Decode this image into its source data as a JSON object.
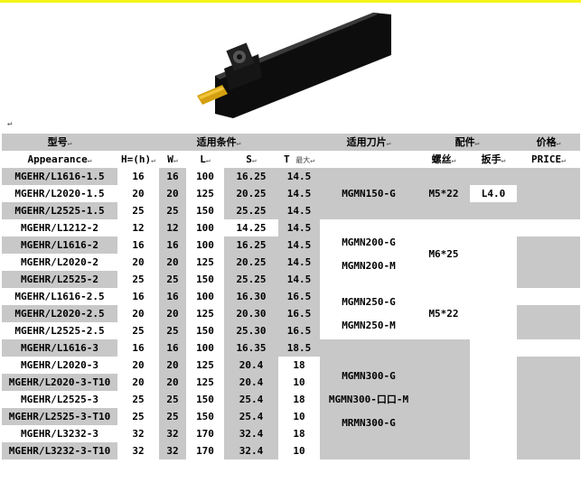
{
  "header": {
    "model": "型号",
    "conditions": "适用条件",
    "insert": "适用刀片",
    "accessories": "配件",
    "price": "价格"
  },
  "subheader": {
    "appearance": "Appearance",
    "h": "H=(h)",
    "w": "W",
    "l": "L",
    "s": "S",
    "t": "T",
    "t_sub": "最大",
    "screw": "螺丝",
    "wrench": "扳手",
    "price": "PRICE"
  },
  "rows": [
    {
      "model": "MGEHR/L1616-1.5",
      "h": "16",
      "w": "16",
      "l": "100",
      "s": "16.25",
      "t": "14.5"
    },
    {
      "model": "MGEHR/L2020-1.5",
      "h": "20",
      "w": "20",
      "l": "125",
      "s": "20.25",
      "t": "14.5"
    },
    {
      "model": "MGEHR/L2525-1.5",
      "h": "25",
      "w": "25",
      "l": "150",
      "s": "25.25",
      "t": "14.5"
    },
    {
      "model": "MGEHR/L1212-2",
      "h": "12",
      "w": "12",
      "l": "100",
      "s": "14.25",
      "t": "14.5"
    },
    {
      "model": "MGEHR/L1616-2",
      "h": "16",
      "w": "16",
      "l": "100",
      "s": "16.25",
      "t": "14.5"
    },
    {
      "model": "MGEHR/L2020-2",
      "h": "20",
      "w": "20",
      "l": "125",
      "s": "20.25",
      "t": "14.5"
    },
    {
      "model": "MGEHR/L2525-2",
      "h": "25",
      "w": "25",
      "l": "150",
      "s": "25.25",
      "t": "14.5"
    },
    {
      "model": "MGEHR/L1616-2.5",
      "h": "16",
      "w": "16",
      "l": "100",
      "s": "16.30",
      "t": "16.5"
    },
    {
      "model": "MGEHR/L2020-2.5",
      "h": "20",
      "w": "20",
      "l": "125",
      "s": "20.30",
      "t": "16.5"
    },
    {
      "model": "MGEHR/L2525-2.5",
      "h": "25",
      "w": "25",
      "l": "150",
      "s": "25.30",
      "t": "16.5"
    },
    {
      "model": "MGEHR/L1616-3",
      "h": "16",
      "w": "16",
      "l": "100",
      "s": "16.35",
      "t": "18.5"
    },
    {
      "model": "MGEHR/L2020-3",
      "h": "20",
      "w": "20",
      "l": "125",
      "s": "20.4",
      "t": "18"
    },
    {
      "model": "MGEHR/L2020-3-T10",
      "h": "20",
      "w": "20",
      "l": "125",
      "s": "20.4",
      "t": "10"
    },
    {
      "model": "MGEHR/L2525-3",
      "h": "25",
      "w": "25",
      "l": "150",
      "s": "25.4",
      "t": "18"
    },
    {
      "model": "MGEHR/L2525-3-T10",
      "h": "25",
      "w": "25",
      "l": "150",
      "s": "25.4",
      "t": "10"
    },
    {
      "model": "MGEHR/L3232-3",
      "h": "32",
      "w": "32",
      "l": "170",
      "s": "32.4",
      "t": "18"
    },
    {
      "model": "MGEHR/L3232-3-T10",
      "h": "32",
      "w": "32",
      "l": "170",
      "s": "32.4",
      "t": "10"
    }
  ],
  "inserts": {
    "g1": "MGMN150-G",
    "g2a": "MGMN200-G",
    "g2b": "MGMN200-M",
    "g3a": "MGMN250-G",
    "g3b": "MGMN250-M",
    "g4a": "MGMN300-G",
    "g4b": "MGMN300-口口-M",
    "g4c": "MRMN300-G"
  },
  "screws": {
    "g1": "M5*22",
    "g2": "M6*25",
    "g3": "M5*22"
  },
  "wrenches": {
    "g1": "L4.0"
  },
  "paragraph_mark": "↵"
}
